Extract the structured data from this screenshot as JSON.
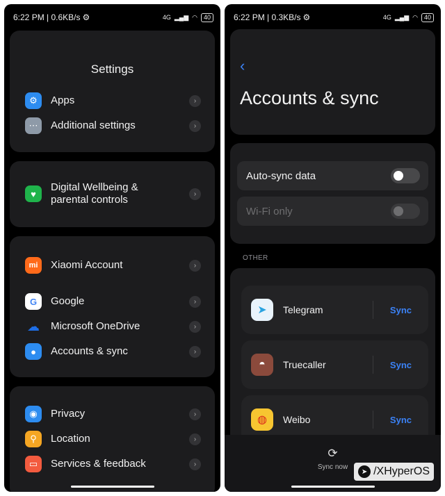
{
  "left": {
    "status": {
      "time": "6:22 PM | 0.6KB/s",
      "battery": "40",
      "network": "4G"
    },
    "title": "Settings",
    "group1": [
      {
        "label": "Apps",
        "icon": "gear-icon",
        "color": "#2d8cf0"
      },
      {
        "label": "Additional settings",
        "icon": "dots-icon",
        "color": "#8e9aa8"
      }
    ],
    "group2": [
      {
        "label": "Digital Wellbeing & parental controls",
        "icon": "heart-icon",
        "color": "#1fb34b"
      }
    ],
    "group3": [
      {
        "label": "Xiaomi Account",
        "icon": "mi-logo-icon",
        "color": "#ff6a1a"
      },
      {
        "label": "Google",
        "icon": "google-logo-icon",
        "color": "#ffffff"
      },
      {
        "label": "Microsoft OneDrive",
        "icon": "cloud-icon",
        "color": "#1e6ee6"
      },
      {
        "label": "Accounts & sync",
        "icon": "person-icon",
        "color": "#2d8cf0"
      }
    ],
    "group4": [
      {
        "label": "Privacy",
        "icon": "eye-icon",
        "color": "#2d8cf0"
      },
      {
        "label": "Location",
        "icon": "pin-icon",
        "color": "#f5a623"
      },
      {
        "label": "Services & feedback",
        "icon": "chat-icon",
        "color": "#f35b3f"
      }
    ]
  },
  "right": {
    "status": {
      "time": "6:22 PM | 0.3KB/s",
      "battery": "40",
      "network": "4G"
    },
    "title": "Accounts & sync",
    "toggles": [
      {
        "label": "Auto-sync data",
        "enabled": true,
        "on": false
      },
      {
        "label": "Wi-Fi only",
        "enabled": false,
        "on": false
      }
    ],
    "section": "OTHER",
    "accounts": [
      {
        "name": "Telegram",
        "icon": "telegram-icon",
        "color": "#e9f3fb",
        "action": "Sync"
      },
      {
        "name": "Truecaller",
        "icon": "android-icon",
        "color": "#8b4a3c",
        "action": "Sync"
      },
      {
        "name": "Weibo",
        "icon": "weibo-icon",
        "color": "#f7c531",
        "action": "Sync"
      }
    ],
    "sync_now": "Sync now"
  },
  "watermark": "/XHyperOS",
  "accent": "#3b82f6"
}
